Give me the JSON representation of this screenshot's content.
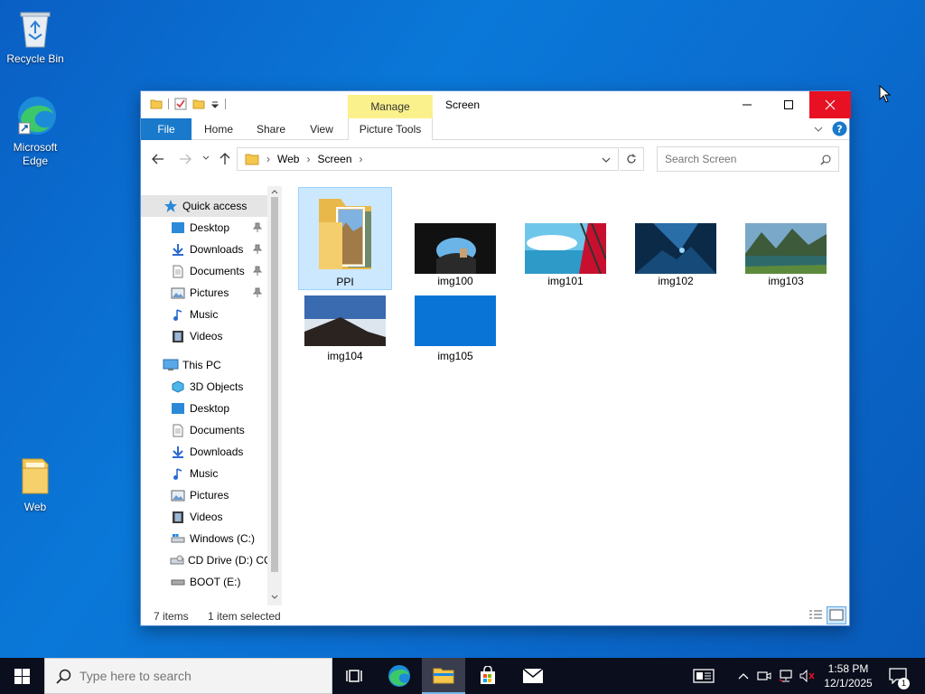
{
  "desktop": {
    "icons": [
      {
        "label": "Recycle Bin"
      },
      {
        "label": "Microsoft Edge"
      },
      {
        "label": "Web"
      }
    ]
  },
  "window": {
    "title": "Screen",
    "context_tab": "Manage",
    "ribbon_tabs": [
      "File",
      "Home",
      "Share",
      "View",
      "Picture Tools"
    ],
    "breadcrumb": [
      "Web",
      "Screen"
    ],
    "search_placeholder": "Search Screen"
  },
  "nav": {
    "quick_access": "Quick access",
    "quick_items": [
      {
        "label": "Desktop",
        "pinned": true
      },
      {
        "label": "Downloads",
        "pinned": true
      },
      {
        "label": "Documents",
        "pinned": true
      },
      {
        "label": "Pictures",
        "pinned": true
      },
      {
        "label": "Music",
        "pinned": false
      },
      {
        "label": "Videos",
        "pinned": false
      }
    ],
    "this_pc": "This PC",
    "pc_items": [
      {
        "label": "3D Objects"
      },
      {
        "label": "Desktop"
      },
      {
        "label": "Documents"
      },
      {
        "label": "Downloads"
      },
      {
        "label": "Music"
      },
      {
        "label": "Pictures"
      },
      {
        "label": "Videos"
      },
      {
        "label": "Windows (C:)"
      },
      {
        "label": "CD Drive (D:) CC"
      },
      {
        "label": "BOOT (E:)"
      }
    ]
  },
  "files": [
    {
      "name": "PPI",
      "type": "folder",
      "selected": true
    },
    {
      "name": "img100",
      "type": "image"
    },
    {
      "name": "img101",
      "type": "image"
    },
    {
      "name": "img102",
      "type": "image"
    },
    {
      "name": "img103",
      "type": "image"
    },
    {
      "name": "img104",
      "type": "image"
    },
    {
      "name": "img105",
      "type": "image"
    }
  ],
  "status": {
    "count": "7 items",
    "selection": "1 item selected"
  },
  "taskbar": {
    "search_placeholder": "Type here to search",
    "time": "1:58 PM",
    "date": "12/1/2025",
    "notification_count": "1"
  }
}
